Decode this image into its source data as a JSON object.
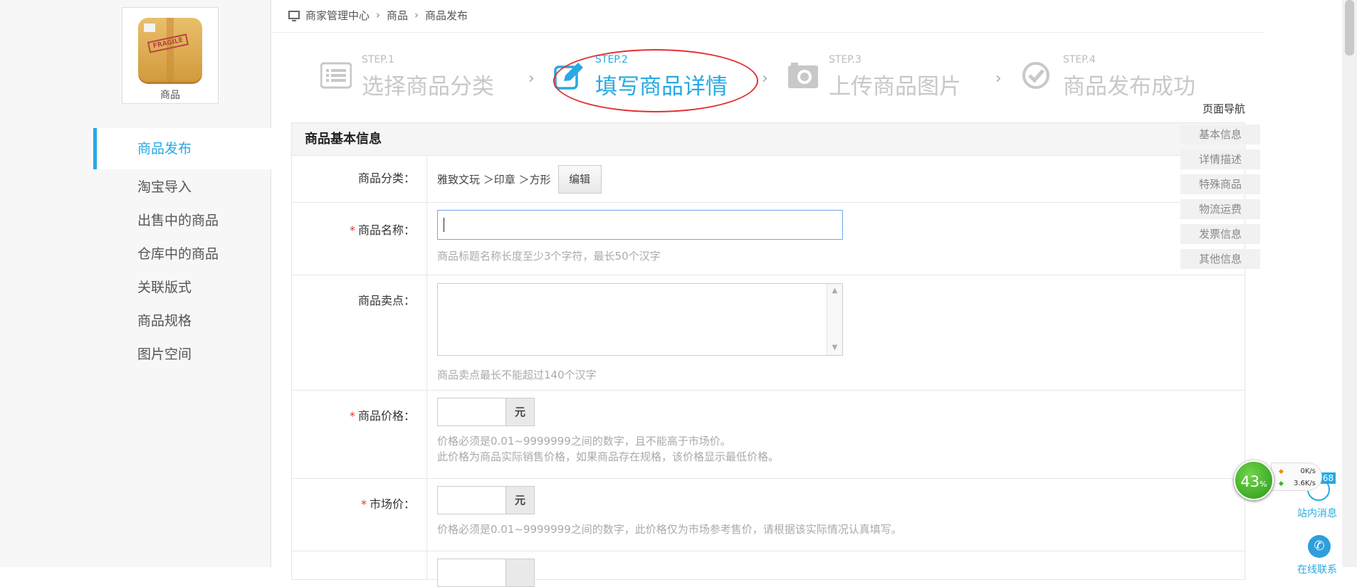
{
  "sidebar": {
    "app_name": "商品",
    "items": [
      {
        "label": "商品发布",
        "active": true
      },
      {
        "label": "淘宝导入"
      },
      {
        "label": "出售中的商品"
      },
      {
        "label": "仓库中的商品"
      },
      {
        "label": "关联版式"
      },
      {
        "label": "商品规格"
      },
      {
        "label": "图片空间"
      }
    ]
  },
  "breadcrumb": [
    "商家管理中心",
    "商品",
    "商品发布"
  ],
  "breadcrumb_sep": "›",
  "steps": [
    {
      "num": "STEP.1",
      "title": "选择商品分类",
      "icon": "list-icon"
    },
    {
      "num": "STEP.2",
      "title": "填写商品详情",
      "icon": "edit-icon",
      "active": true
    },
    {
      "num": "STEP.3",
      "title": "上传商品图片",
      "icon": "camera-icon"
    },
    {
      "num": "STEP.4",
      "title": "商品发布成功",
      "icon": "check-circle-icon"
    }
  ],
  "step_sep": "›",
  "form": {
    "section_title": "商品基本信息",
    "category": {
      "label": "商品分类：",
      "value": "雅致文玩 ＞印章 ＞方形",
      "edit_label": "编辑"
    },
    "name": {
      "label": "商品名称：",
      "value": "",
      "hint": "商品标题名称长度至少3个字符，最长50个汉字"
    },
    "selling_point": {
      "label": "商品卖点：",
      "value": "",
      "hint": "商品卖点最长不能超过140个汉字"
    },
    "price": {
      "label": "商品价格：",
      "unit": "元",
      "hint1": "价格必须是0.01~9999999之间的数字，且不能高于市场价。",
      "hint2": "此价格为商品实际销售价格，如果商品存在规格，该价格显示最低价格。"
    },
    "market_price": {
      "label": "市场价：",
      "unit": "元",
      "hint": "价格必须是0.01~9999999之间的数字，此价格仅为市场参考售价，请根据该实际情况认真填写。"
    },
    "required_mark": "*"
  },
  "page_nav": {
    "title": "页面导航",
    "items": [
      "基本信息",
      "详情描述",
      "特殊商品",
      "物流运费",
      "发票信息",
      "其他信息"
    ]
  },
  "widgets": {
    "gauge_value": "43",
    "gauge_unit": "%",
    "upload_speed": "0K/s",
    "download_speed": "3.6K/s",
    "badge_count": "68",
    "message_label": "站内消息",
    "online_label": "在线联系"
  },
  "colors": {
    "accent": "#27a9e3",
    "required": "#e33333",
    "annotation": "#e23030"
  }
}
